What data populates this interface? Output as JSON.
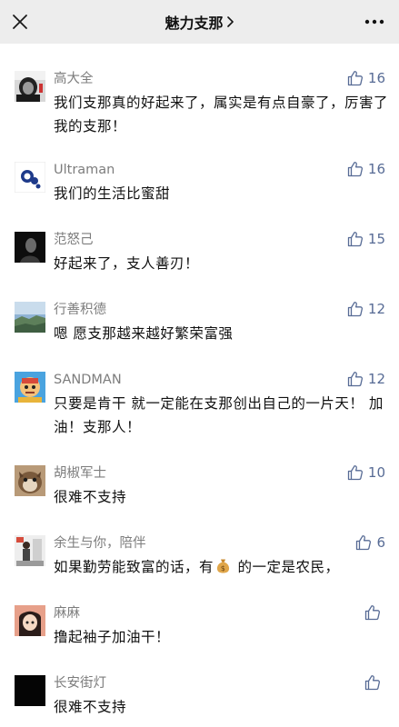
{
  "header": {
    "title": "魅力支那",
    "close_icon": "close-icon",
    "more_icon": "more-dots-icon",
    "chevron_icon": "chevron-right-icon"
  },
  "colors": {
    "header_bg": "#ededed",
    "username": "#7d7d7d",
    "like_accent": "#576b95",
    "text": "#111111"
  },
  "comments": [
    {
      "user": "高大全",
      "text": "我们支那真的好起来了，属实是有点自豪了，厉害了我的支那！",
      "likes": "16"
    },
    {
      "user": "Ultraman",
      "text": "我们的生活比蜜甜",
      "likes": "16"
    },
    {
      "user": "范怒己",
      "text": "好起来了，支人善刃！",
      "likes": "15"
    },
    {
      "user": "行善积德",
      "text": "嗯 愿支那越来越好繁荣富强",
      "likes": "12"
    },
    {
      "user": "SANDMAN",
      "text": "只要是肯干 就一定能在支那创出自己的一片天！ 加油！支那人！",
      "likes": "12"
    },
    {
      "user": "胡椒军士",
      "text": "很难不支持",
      "likes": "10"
    },
    {
      "user": "余生与你，陪伴",
      "text_before": "如果勤劳能致富的话，有",
      "emoji": "money-bag-icon",
      "text_after": " 的一定是农民，",
      "likes": "6"
    },
    {
      "user": "麻麻",
      "text": "撸起袖子加油干！",
      "likes": ""
    },
    {
      "user": "长安街灯",
      "text": "很难不支持",
      "likes": ""
    }
  ]
}
